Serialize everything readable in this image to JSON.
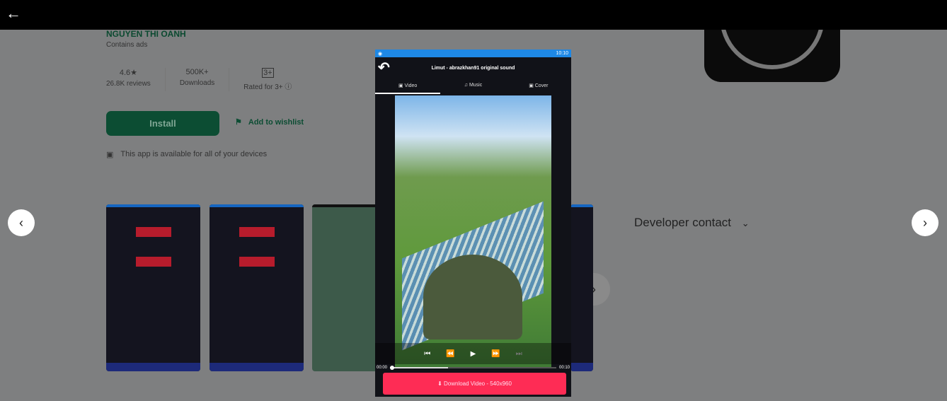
{
  "developer": "NGUYEN THI OANH",
  "contains_ads": "Contains ads",
  "stats": [
    {
      "value": "4.6★",
      "label": "26.8K reviews"
    },
    {
      "value": "500K+",
      "label": "Downloads"
    },
    {
      "value": "3+",
      "label": "Rated for 3+ ⓘ"
    }
  ],
  "install": "Install",
  "wishlist": "Add to wishlist",
  "availability": "This app is available for all of your devices",
  "developer_contact": "Developer contact",
  "phone": {
    "time": "10:10",
    "title": "Limut - abrazkhan91 original sound",
    "tabs": [
      "Video",
      "Music",
      "Cover"
    ],
    "time_start": "00:00",
    "time_end": "00:10",
    "progress": 0.35,
    "download": "⬇ Download Video - 540x960"
  },
  "colors": {
    "install": "#0c4d33",
    "download": "#fe2c55",
    "statusbar": "#1e88e5"
  }
}
